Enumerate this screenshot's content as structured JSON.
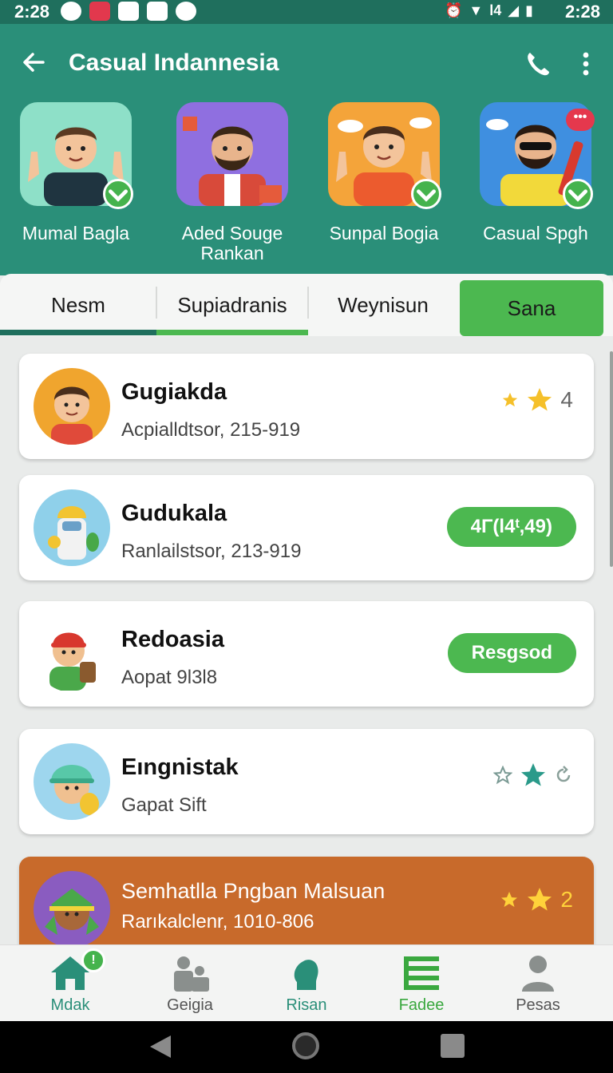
{
  "status_bar": {
    "time_left": "2:28",
    "time_right": "2:28",
    "network": "l4"
  },
  "app_bar": {
    "title": "Casual Indannesia"
  },
  "contacts": [
    {
      "name": "Mumal Bagla",
      "bg": "#8ee0c8",
      "verified": true
    },
    {
      "name": "Aded Souge Rankan",
      "bg": "#8f6fe0",
      "verified": false
    },
    {
      "name": "Sunpal Bogia",
      "bg": "#f4a43a",
      "verified": true
    },
    {
      "name": "Casual Spgh",
      "bg": "#3f8fe0",
      "verified": true,
      "badge": "•••"
    }
  ],
  "tabs": [
    "Nesm",
    "Supiadranis",
    "Weynisun",
    "Sana"
  ],
  "list": [
    {
      "name": "Gugiakda",
      "subtitle": "Acpialldtsor, 215-919",
      "rating": "4"
    },
    {
      "name": "Gudukala",
      "subtitle": "Ranlailstsor, 213-919",
      "pill": "4Γ(l4ᵗ,49)"
    },
    {
      "name": "Redoasia",
      "subtitle": "Aopat 9l3l8",
      "pill": "Resgsod"
    },
    {
      "name": "Eıngnistak",
      "subtitle": "Gapat Sift"
    },
    {
      "name": "Semhatlla Pngban Malsuan",
      "subtitle": "Rarıkalclenr, 1010-806",
      "rating": "2"
    }
  ],
  "bottom_nav": [
    {
      "label": "Mdak",
      "color": "#2a8f79",
      "badge": "!"
    },
    {
      "label": "Geigia",
      "color": "#555555"
    },
    {
      "label": "Risan",
      "color": "#2a8f79"
    },
    {
      "label": "Fadee",
      "color": "#3aa83f"
    },
    {
      "label": "Pesas",
      "color": "#555555"
    }
  ],
  "colors": {
    "primary": "#2a8f79",
    "primary_dark": "#1f6f5d",
    "accent": "#4cb850",
    "star": "#f5c02a"
  }
}
